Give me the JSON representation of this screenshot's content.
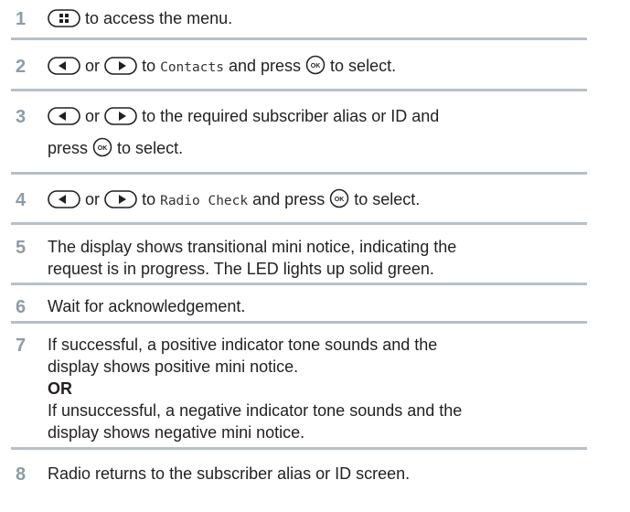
{
  "steps": [
    {
      "number": "1",
      "text_a": "to access the menu."
    },
    {
      "number": "2",
      "text_or": "or",
      "text_a": "to",
      "mono": "Contacts",
      "text_b": "and press",
      "text_c": "to select."
    },
    {
      "number": "3",
      "text_or": "or",
      "text_a": "to the required subscriber alias or ID and",
      "text_b": "press",
      "text_c": "to select."
    },
    {
      "number": "4",
      "text_or": "or",
      "text_a": "to",
      "mono": "Radio Check",
      "text_b": "and press",
      "text_c": "to select."
    },
    {
      "number": "5",
      "line1": "The display shows transitional mini notice, indicating the",
      "line2": "request is in progress. The LED lights up solid green."
    },
    {
      "number": "6",
      "line1": "Wait for acknowledgement."
    },
    {
      "number": "7",
      "line1": "If successful, a positive indicator tone sounds and the",
      "line2": "display shows positive mini notice.",
      "or_label": "OR",
      "line3": "If unsuccessful, a negative indicator tone sounds and the",
      "line4": "display shows negative mini notice."
    },
    {
      "number": "8",
      "line1": "Radio returns to the subscriber alias or ID screen."
    }
  ],
  "icons": {
    "menu": "menu-button-icon",
    "left": "left-navigation-button-icon",
    "right": "right-navigation-button-icon",
    "ok": "ok-button-icon",
    "ok_label": "OK"
  }
}
